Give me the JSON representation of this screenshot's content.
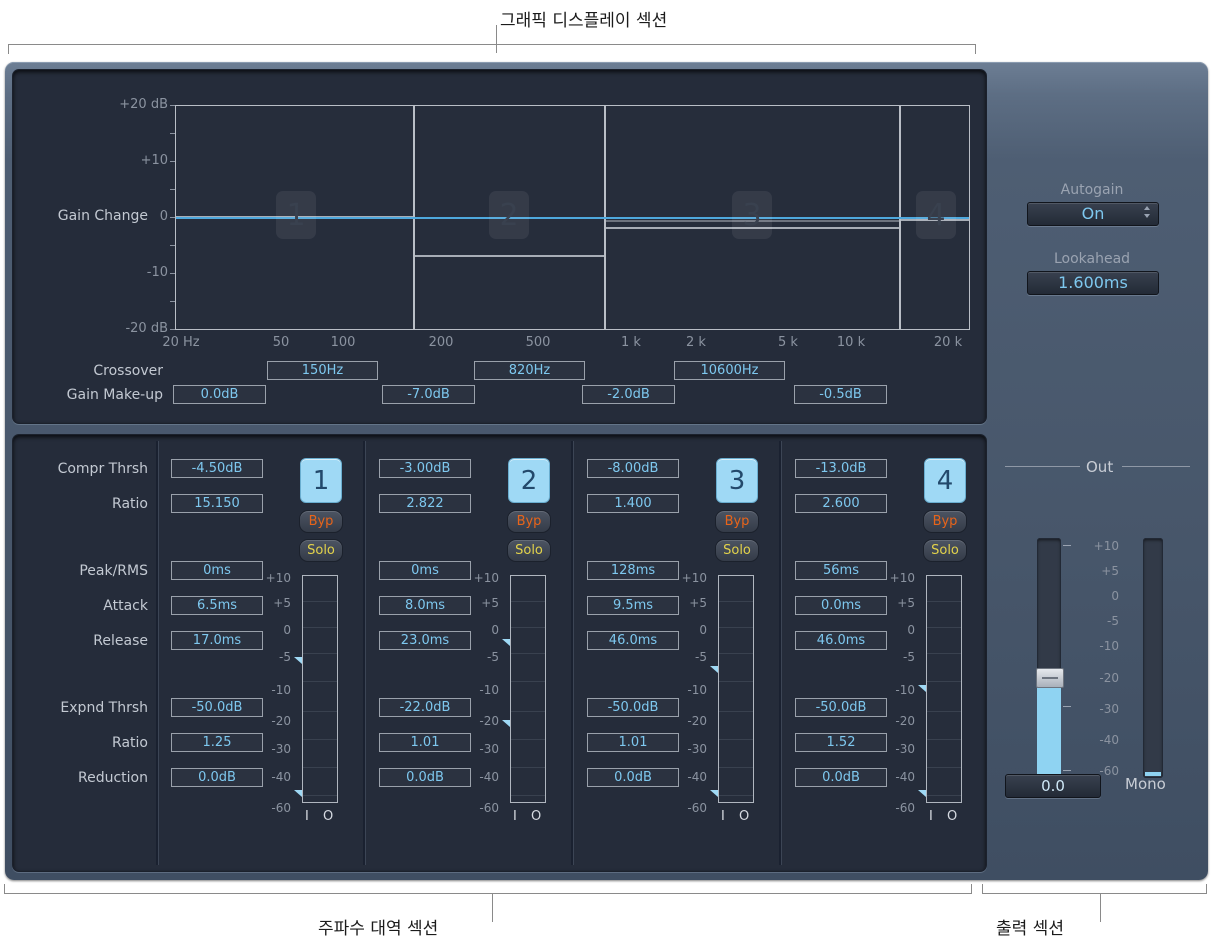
{
  "annotations": {
    "graphic_display": "그래픽 디스플레이 섹션",
    "frequency_band": "주파수 대역 섹션",
    "output": "출력 섹션"
  },
  "graph": {
    "y_axis_label": "Gain Change",
    "y_ticks": [
      "+20 dB",
      "+10",
      "0",
      "-10",
      "-20 dB"
    ],
    "x_ticks": [
      "20 Hz",
      "50",
      "100",
      "200",
      "500",
      "1 k",
      "2 k",
      "5 k",
      "10 k",
      "20 k"
    ],
    "band_badges": [
      "1",
      "2",
      "3",
      "4"
    ],
    "crossover_label": "Crossover",
    "crossover_values": [
      "150Hz",
      "820Hz",
      "10600Hz"
    ],
    "gain_makeup_label": "Gain Make-up",
    "gain_makeup_values": [
      "0.0dB",
      "-7.0dB",
      "-2.0dB",
      "-0.5dB"
    ],
    "autogain_label": "Autogain",
    "autogain_value": "On",
    "lookahead_label": "Lookahead",
    "lookahead_value": "1.600ms"
  },
  "bands_section": {
    "row_labels": [
      "Compr Thrsh",
      "Ratio",
      "Peak/RMS",
      "Attack",
      "Release",
      "Expnd Thrsh",
      "Ratio",
      "Reduction"
    ],
    "meter_scale": [
      "+10",
      "+5",
      "0",
      "-5",
      "-10",
      "-20",
      "-30",
      "-40",
      "-60"
    ],
    "io_label": "I O",
    "bypass_label": "Byp",
    "solo_label": "Solo",
    "bands": [
      {
        "number": "1",
        "compr_thrsh": "-4.50dB",
        "ratio": "15.150",
        "peak_rms": "0ms",
        "attack": "6.5ms",
        "release": "17.0ms",
        "expnd_thrsh": "-50.0dB",
        "expnd_ratio": "1.25",
        "reduction": "0.0dB"
      },
      {
        "number": "2",
        "compr_thrsh": "-3.00dB",
        "ratio": "2.822",
        "peak_rms": "0ms",
        "attack": "8.0ms",
        "release": "23.0ms",
        "expnd_thrsh": "-22.0dB",
        "expnd_ratio": "1.01",
        "reduction": "0.0dB"
      },
      {
        "number": "3",
        "compr_thrsh": "-8.00dB",
        "ratio": "1.400",
        "peak_rms": "128ms",
        "attack": "9.5ms",
        "release": "46.0ms",
        "expnd_thrsh": "-50.0dB",
        "expnd_ratio": "1.01",
        "reduction": "0.0dB"
      },
      {
        "number": "4",
        "compr_thrsh": "-13.0dB",
        "ratio": "2.600",
        "peak_rms": "56ms",
        "attack": "0.0ms",
        "release": "46.0ms",
        "expnd_thrsh": "-50.0dB",
        "expnd_ratio": "1.52",
        "reduction": "0.0dB"
      }
    ]
  },
  "output_section": {
    "title": "Out",
    "scale": [
      "+10",
      "+5",
      "0",
      "-5",
      "-10",
      "-20",
      "-30",
      "-40",
      "-60"
    ],
    "gain_value": "0.0",
    "mono_label": "Mono"
  },
  "colors": {
    "accent_blue": "#7ec8ef",
    "band_button": "#9fd9f5",
    "bypass": "#e8641a",
    "solo": "#e2d24b",
    "curve": "#4ea8dd"
  }
}
